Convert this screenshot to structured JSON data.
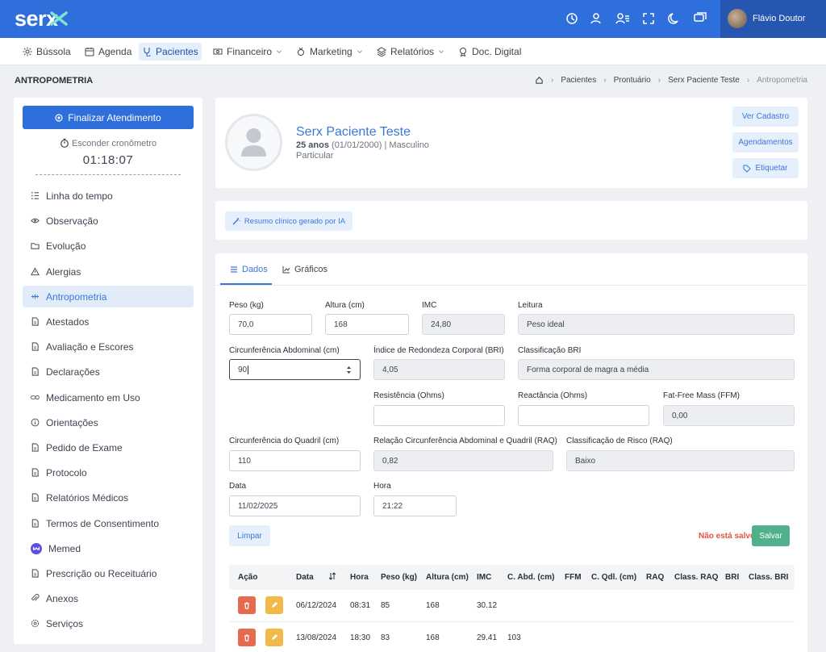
{
  "app": {
    "logo": "serx",
    "user_name": "Flávio Doutor"
  },
  "nav": [
    {
      "label": "Bússola",
      "icon": "compass-icon"
    },
    {
      "label": "Agenda",
      "icon": "calendar-icon"
    },
    {
      "label": "Pacientes",
      "icon": "stethoscope-icon",
      "active": true
    },
    {
      "label": "Financeiro",
      "icon": "money-icon",
      "dropdown": true
    },
    {
      "label": "Marketing",
      "icon": "medal-icon",
      "dropdown": true
    },
    {
      "label": "Relatórios",
      "icon": "layers-icon",
      "dropdown": true
    },
    {
      "label": "Doc. Digital",
      "icon": "award-icon"
    }
  ],
  "page": {
    "title": "ANTROPOMETRIA"
  },
  "breadcrumb": [
    "Pacientes",
    "Prontuário",
    "Serx Paciente Teste",
    "Antropometria"
  ],
  "sidebar": {
    "finalizar": "Finalizar Atendimento",
    "esconder": "Esconder cronômetro",
    "timer": "01:18:07",
    "items": [
      {
        "label": "Linha do tempo",
        "icon": "timeline-icon"
      },
      {
        "label": "Observação",
        "icon": "eye-icon"
      },
      {
        "label": "Evolução",
        "icon": "folder-icon"
      },
      {
        "label": "Alergias",
        "icon": "warning-icon"
      },
      {
        "label": "Antropometria",
        "icon": "ruler-icon",
        "active": true
      },
      {
        "label": "Atestados",
        "icon": "document-icon"
      },
      {
        "label": "Avaliação e Escores",
        "icon": "document-icon"
      },
      {
        "label": "Declarações",
        "icon": "document-icon"
      },
      {
        "label": "Medicamento em Uso",
        "icon": "pills-icon"
      },
      {
        "label": "Orientações",
        "icon": "info-icon"
      },
      {
        "label": "Pedido de Exame",
        "icon": "document-icon"
      },
      {
        "label": "Protocolo",
        "icon": "document-icon"
      },
      {
        "label": "Relatórios Médicos",
        "icon": "document-icon"
      },
      {
        "label": "Termos de Consentimento",
        "icon": "document-icon"
      },
      {
        "label": "Memed",
        "icon": "memed-icon"
      },
      {
        "label": "Prescrição ou Receituário",
        "icon": "document-icon"
      },
      {
        "label": "Anexos",
        "icon": "paperclip-icon"
      },
      {
        "label": "Serviços",
        "icon": "gear-icon"
      }
    ]
  },
  "patient": {
    "name": "Serx Paciente Teste",
    "age": "25 anos",
    "birth": "(01/01/2000)",
    "sex": "Masculino",
    "plan": "Particular",
    "btn_cadastro": "Ver Cadastro",
    "btn_agendamentos": "Agendamentos",
    "btn_etiquetar": "Etiquetar"
  },
  "ai": {
    "label": "Resumo clínico gerado por IA"
  },
  "tabs": {
    "dados": "Dados",
    "graficos": "Gráficos"
  },
  "form": {
    "peso": {
      "label": "Peso (kg)",
      "value": "70,0"
    },
    "altura": {
      "label": "Altura (cm)",
      "value": "168"
    },
    "imc": {
      "label": "IMC",
      "value": "24,80"
    },
    "leitura": {
      "label": "Leitura",
      "value": "Peso ideal"
    },
    "abdominal": {
      "label": "Circunferência Abdominal (cm)",
      "value": "90"
    },
    "bri": {
      "label": "Índice de Redondeza Corporal (BRI)",
      "value": "4,05"
    },
    "class_bri": {
      "label": "Classificação BRI",
      "value": "Forma corporal de magra a média"
    },
    "resistencia": {
      "label": "Resistência (Ohms)",
      "value": ""
    },
    "reactancia": {
      "label": "Reactância (Ohms)",
      "value": ""
    },
    "ffm": {
      "label": "Fat-Free Mass (FFM)",
      "value": "0,00"
    },
    "quadril": {
      "label": "Circunferência do Quadril (cm)",
      "value": "110"
    },
    "raq": {
      "label": "Relação Circunferência Abdominal e Quadril (RAQ)",
      "value": "0,82"
    },
    "class_raq": {
      "label": "Classificação de Risco (RAQ)",
      "value": "Baixo"
    },
    "data": {
      "label": "Data",
      "value": "11/02/2025"
    },
    "hora": {
      "label": "Hora",
      "value": "21:22"
    },
    "limpar": "Limpar",
    "unsaved": "Não está salvo",
    "salvar": "Salvar"
  },
  "table": {
    "headers": [
      "Ação",
      "Data",
      "Hora",
      "Peso (kg)",
      "Altura (cm)",
      "IMC",
      "C. Abd. (cm)",
      "FFM",
      "C. Qdl. (cm)",
      "RAQ",
      "Class. RAQ",
      "BRI",
      "Class. BRI"
    ],
    "rows": [
      {
        "data": "06/12/2024",
        "hora": "08:31",
        "peso": "85",
        "altura": "168",
        "imc": "30.12",
        "cabd": ""
      },
      {
        "data": "13/08/2024",
        "hora": "18:30",
        "peso": "83",
        "altura": "168",
        "imc": "29.41",
        "cabd": "103"
      }
    ]
  },
  "colors": {
    "primary": "#2f6fdc",
    "accent": "#3a78d8",
    "success": "#4fb08a",
    "danger": "#e56a4f",
    "warning": "#f1b94a"
  }
}
